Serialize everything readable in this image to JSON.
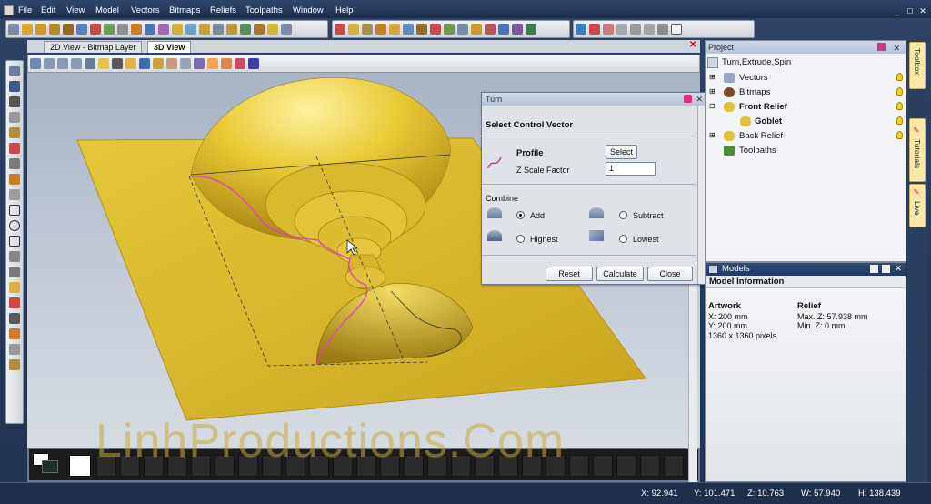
{
  "menu": [
    "File",
    "Edit",
    "View",
    "Model",
    "Vectors",
    "Bitmaps",
    "Reliefs",
    "Toolpaths",
    "Window",
    "Help"
  ],
  "tabs": [
    {
      "label": "2D View - Bitmap Layer"
    },
    {
      "label": "3D View"
    }
  ],
  "dialog": {
    "title": "Turn",
    "section": "Select Control Vector",
    "profile_label": "Profile",
    "select_button": "Select",
    "z_scale_label": "Z Scale Factor",
    "z_scale_value": "1",
    "combine_label": "Combine",
    "opt_add": "Add",
    "opt_subtract": "Subtract",
    "opt_highest": "Highest",
    "opt_lowest": "Lowest",
    "selected_option": "Add",
    "reset_button": "Reset",
    "calculate_button": "Calculate",
    "close_button": "Close"
  },
  "project": {
    "title": "Project",
    "root": "Turn,Extrude,Spin",
    "items": [
      "Vectors",
      "Bitmaps",
      "Front Relief",
      "Goblet",
      "Back Relief",
      "Toolpaths"
    ]
  },
  "models": {
    "title": "Models",
    "section": "Model Information",
    "artwork_heading": "Artwork",
    "artwork_x": "X: 200 mm",
    "artwork_y": "Y: 200 mm",
    "artwork_pixels": "1360 x 1360 pixels",
    "relief_heading": "Relief",
    "relief_max": "Max. Z: 57.938 mm",
    "relief_min": "Min. Z: 0 mm"
  },
  "sidetabs": [
    "Toolbox",
    "Tutorials",
    "Live"
  ],
  "status": {
    "x": "X: 92.941",
    "y": "Y: 101.471",
    "z": "Z: 10.763",
    "w": "W: 57.940",
    "h": "H: 138.439"
  },
  "watermark": "LinhProductions.Com",
  "colors": {
    "relief": "#e6c83a",
    "vector": "#e03dc8",
    "titlebar": "#1f3352"
  }
}
